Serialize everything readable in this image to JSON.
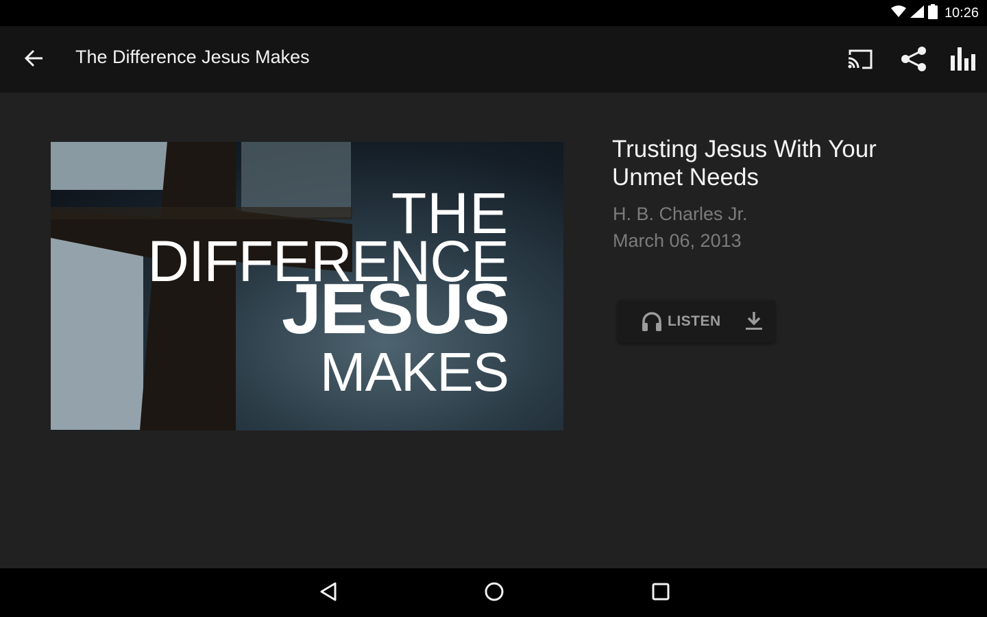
{
  "status_bar": {
    "time": "10:26",
    "icons": [
      "wifi-icon",
      "cell-signal-icon",
      "battery-icon"
    ]
  },
  "app_bar": {
    "title": "The Difference Jesus Makes",
    "back_icon": "arrow-back-icon",
    "actions": [
      "cast-icon",
      "share-icon",
      "equalizer-icon"
    ]
  },
  "sermon": {
    "artwork_lines": [
      "THE",
      "DIFFERENCE",
      "JESUS",
      "MAKES"
    ],
    "title": "Trusting Jesus With Your Unmet Needs",
    "speaker": "H. B. Charles Jr.",
    "date": "March 06, 2013",
    "listen_label": "LISTEN",
    "listen_icon": "headphones-icon",
    "download_icon": "download-icon"
  },
  "nav_bar": {
    "buttons": [
      "back-triangle-icon",
      "home-circle-icon",
      "recents-square-icon"
    ]
  },
  "colors": {
    "status_bar_bg": "#000000",
    "app_bar_bg": "#141414",
    "content_bg": "#212121",
    "title_text": "#f4f4f4",
    "secondary_text": "#7c7c7c",
    "button_bg": "#1a1a1a",
    "button_text": "#9c9c9c"
  }
}
